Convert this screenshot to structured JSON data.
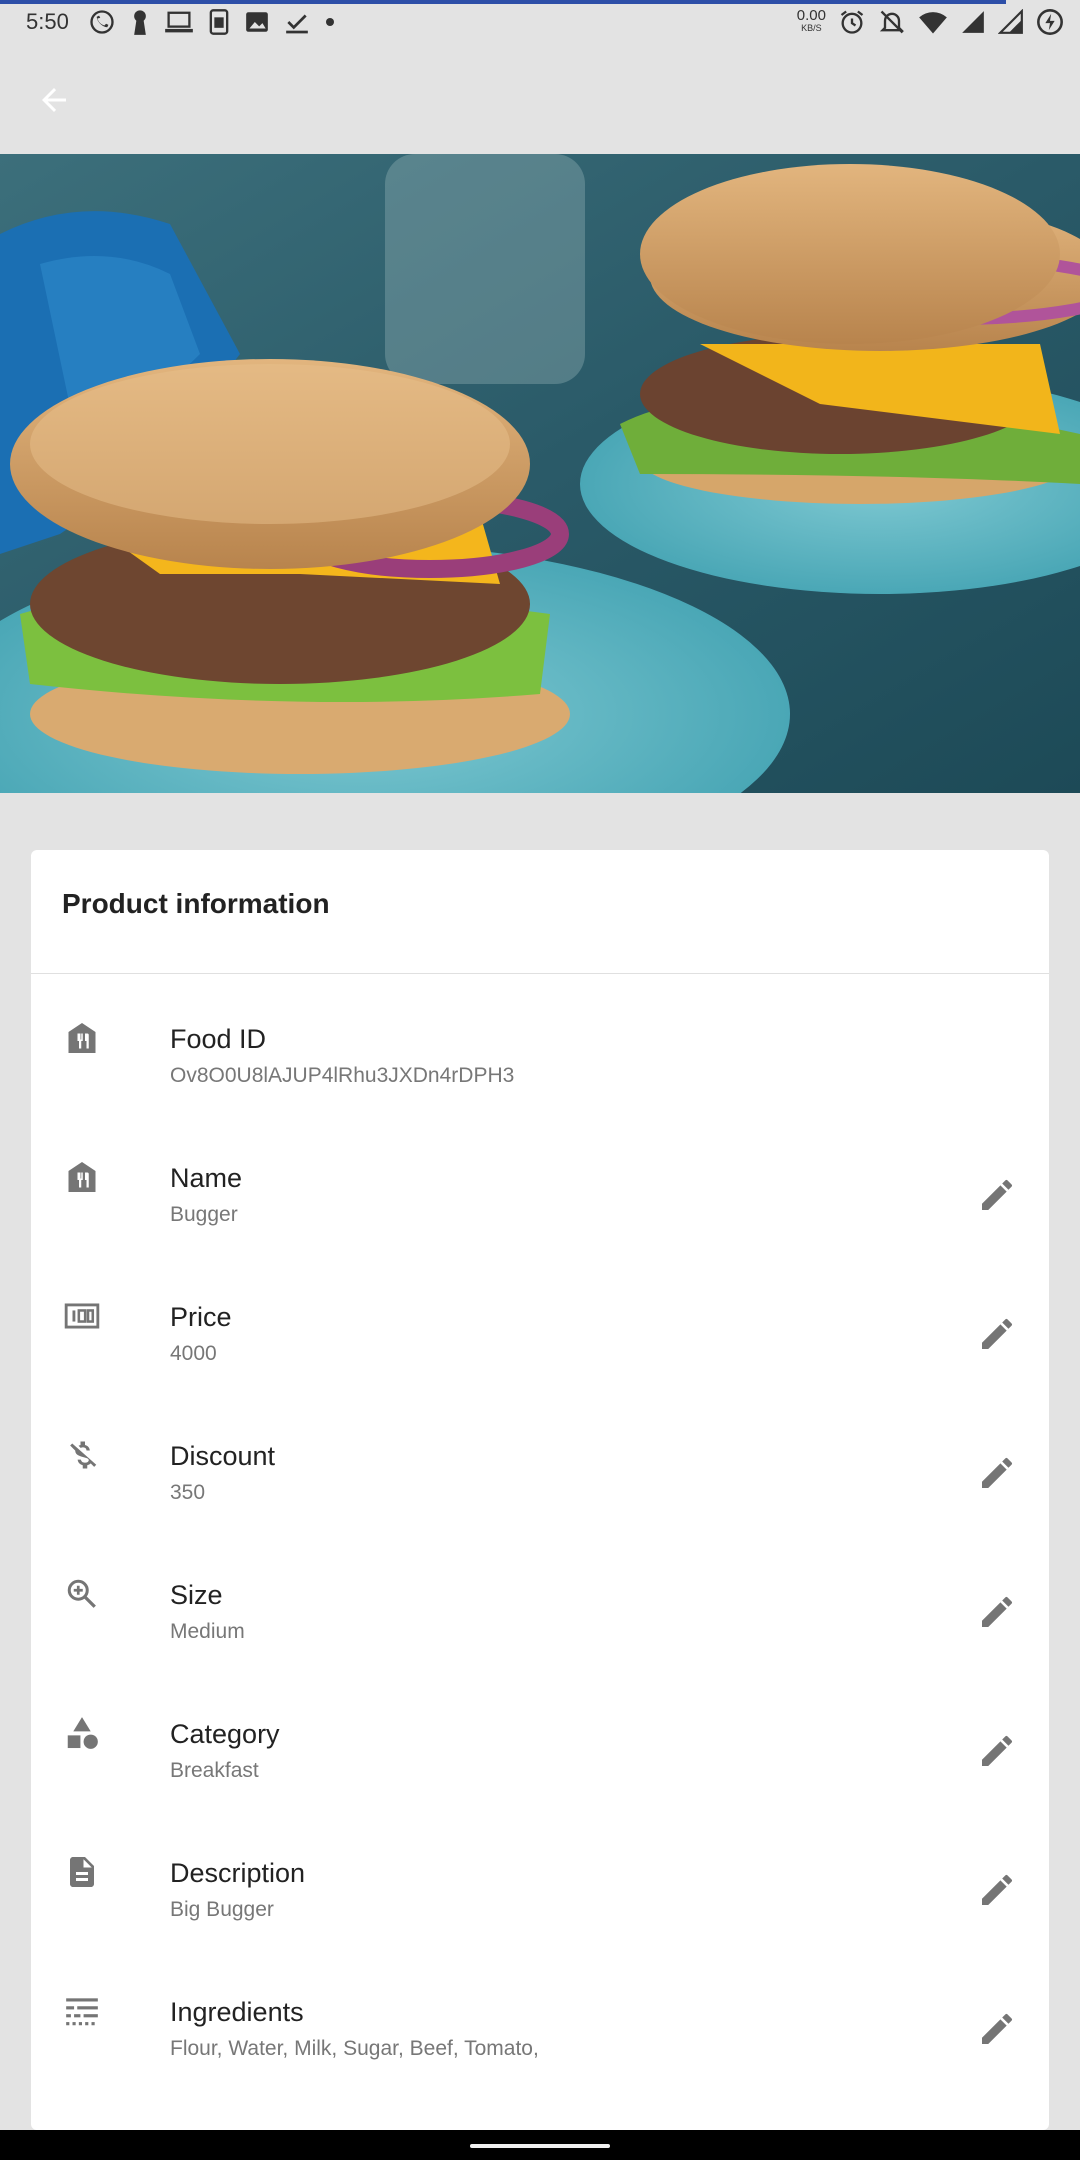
{
  "status_bar": {
    "time": "5:50",
    "net_speed_value": "0.00",
    "net_speed_unit": "KB/S",
    "left_icons": [
      "whatsapp-icon",
      "keyhole-icon",
      "laptop-icon",
      "sim-icon",
      "image-icon",
      "checkbox-icon",
      "dot-icon"
    ],
    "right_icons": [
      "alarm-icon",
      "bell-off-icon",
      "wifi-icon",
      "signal-icon",
      "roaming-signal-icon",
      "battery-icon"
    ]
  },
  "app_bar": {
    "back_icon": "arrow-back-icon"
  },
  "hero": {
    "image_subject": "burger-photo"
  },
  "card": {
    "title": "Product information",
    "rows": [
      {
        "icon": "food-store-icon",
        "label": "Food ID",
        "value": "Ov8O0U8lAJUP4lRhu3JXDn4rDPH3",
        "editable": false
      },
      {
        "icon": "food-store-icon",
        "label": "Name",
        "value": "Bugger",
        "editable": true
      },
      {
        "icon": "money-icon",
        "label": "Price",
        "value": "4000",
        "editable": true
      },
      {
        "icon": "money-off-icon",
        "label": "Discount",
        "value": "350",
        "editable": true
      },
      {
        "icon": "zoom-in-icon",
        "label": "Size",
        "value": "Medium",
        "editable": true
      },
      {
        "icon": "category-icon",
        "label": "Category",
        "value": "Breakfast",
        "editable": true
      },
      {
        "icon": "description-icon",
        "label": "Description",
        "value": "Big Bugger",
        "editable": true
      },
      {
        "icon": "ingredients-icon",
        "label": "Ingredients",
        "value": "Flour, Water, Milk, Sugar, Beef, Tomato,",
        "editable": true
      }
    ]
  },
  "colors": {
    "background": "#e3e3e3",
    "card": "#ffffff",
    "icon": "#757575",
    "progress": "#2d4fa8"
  }
}
